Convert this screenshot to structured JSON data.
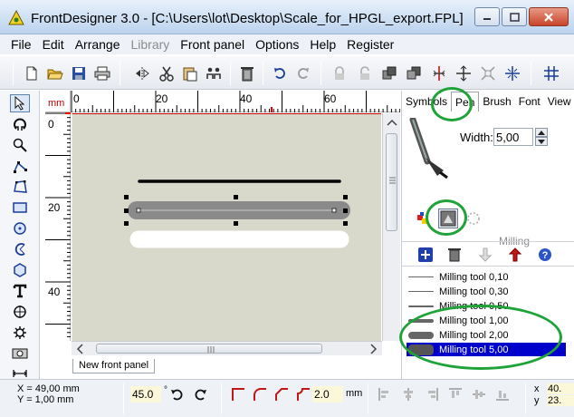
{
  "window": {
    "title": "FrontDesigner 3.0 - [C:\\Users\\lot\\Desktop\\Scale_for_HPGL_export.FPL]"
  },
  "menu": [
    {
      "label": "File",
      "enabled": true
    },
    {
      "label": "Edit",
      "enabled": true
    },
    {
      "label": "Arrange",
      "enabled": true
    },
    {
      "label": "Library",
      "enabled": false
    },
    {
      "label": "Front panel",
      "enabled": true
    },
    {
      "label": "Options",
      "enabled": true
    },
    {
      "label": "Help",
      "enabled": true
    },
    {
      "label": "Register",
      "enabled": true
    }
  ],
  "toolbar_icons": [
    "new-file-icon",
    "open-folder-icon",
    "save-icon",
    "print-icon",
    "mirror-icon",
    "cut-icon",
    "paste-icon",
    "group-icon",
    "delete-icon",
    "undo-icon",
    "redo-icon",
    "lock-icon",
    "lock-open-icon",
    "bring-front-icon",
    "send-back-icon",
    "align-center-icon",
    "center-icon",
    "fit-icon",
    "zoom-fit-icon",
    "grid-icon"
  ],
  "left_tools": [
    "select-arrow-icon",
    "rotate-icon",
    "zoom-icon",
    "polyline-icon",
    "polygon-icon",
    "rectangle-icon",
    "circle-icon",
    "arc-icon",
    "hexagon-icon",
    "text-icon",
    "drill-hole-icon",
    "gear-icon",
    "milling-icon",
    "dimension-icon"
  ],
  "rulers": {
    "unit": "mm",
    "h_labels": [
      "0",
      "20",
      "40",
      "60"
    ],
    "v_labels": [
      "0",
      "20",
      "40"
    ]
  },
  "document_tab": "New front panel",
  "right_panel": {
    "tabs": [
      "Symbols",
      "Pen",
      "Brush",
      "Font",
      "View"
    ],
    "active_tab": "Pen",
    "width_label": "Width:",
    "width_value": "5,00",
    "milling_label": "Milling",
    "tools": [
      {
        "label": "Milling tool 0,10",
        "thickness": 0.1,
        "selected": false
      },
      {
        "label": "Milling tool 0,30",
        "thickness": 0.3,
        "selected": false
      },
      {
        "label": "Milling tool 0,50",
        "thickness": 0.5,
        "selected": false
      },
      {
        "label": "Milling tool 1,00",
        "thickness": 1.0,
        "selected": false
      },
      {
        "label": "Milling tool 2,00",
        "thickness": 2.0,
        "selected": false
      },
      {
        "label": "Milling tool 5,00",
        "thickness": 5.0,
        "selected": true
      }
    ]
  },
  "status": {
    "x_coord": "X = 49,00 mm",
    "y_coord": "Y = 1,00 mm",
    "angle": "45.0",
    "degree_symbol": "°",
    "radius": "2.0",
    "unit": "mm",
    "x_label": "x",
    "y_label": "y",
    "x_value": "40.",
    "y_value": "23."
  },
  "colors": {
    "accent_selection": "#0000cc",
    "canvas_bg": "#d8d8cb",
    "annotation": "#1fa338",
    "ruler_unit": "#c00000"
  }
}
